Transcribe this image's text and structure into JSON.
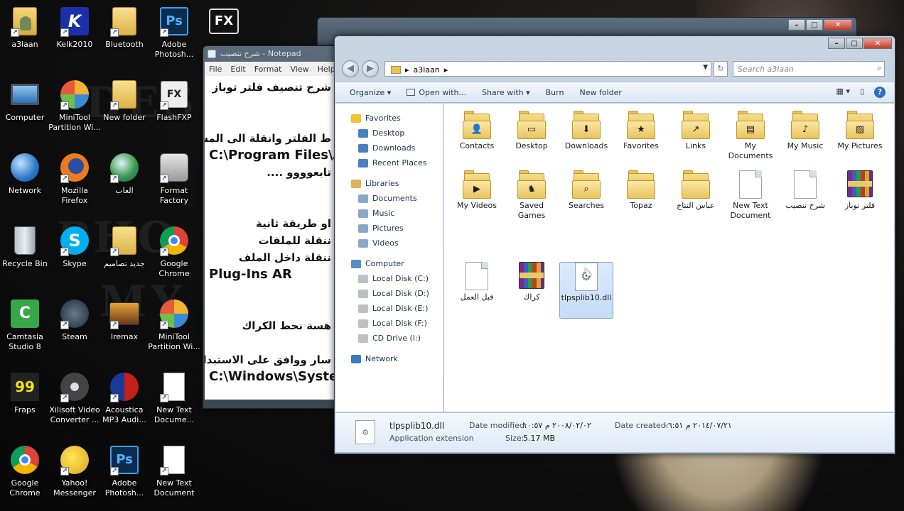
{
  "desktop": {
    "icons": [
      {
        "label": "a3laan",
        "icon": "user-folder-icon"
      },
      {
        "label": "Kelk2010",
        "icon": "kelk-app-icon"
      },
      {
        "label": "Bluetooth",
        "icon": "folder-icon"
      },
      {
        "label": "Adobe Photosh...",
        "icon": "photoshop-icon"
      },
      {
        "label": "Computer",
        "icon": "computer-icon"
      },
      {
        "label": "MiniTool Partition Wi...",
        "icon": "minitool-icon"
      },
      {
        "label": "New folder",
        "icon": "folder-icon"
      },
      {
        "label": "FlashFXP",
        "icon": "flashfxp-icon"
      },
      {
        "label": "Network",
        "icon": "network-icon"
      },
      {
        "label": "Mozilla Firefox",
        "icon": "firefox-icon"
      },
      {
        "label": "العاب",
        "icon": "games-globe-icon"
      },
      {
        "label": "Format Factory",
        "icon": "format-factory-icon"
      },
      {
        "label": "Recycle Bin",
        "icon": "recycle-bin-icon"
      },
      {
        "label": "Skype",
        "icon": "skype-icon"
      },
      {
        "label": "جديد تصاميم",
        "icon": "folder-icon"
      },
      {
        "label": "Google Chrome",
        "icon": "chrome-icon"
      },
      {
        "label": "Camtasia Studio 8",
        "icon": "camtasia-icon"
      },
      {
        "label": "Steam",
        "icon": "steam-icon"
      },
      {
        "label": "Iremax",
        "icon": "iremax-icon"
      },
      {
        "label": "MiniTool Partition Wi...",
        "icon": "minitool-icon"
      },
      {
        "label": "Fraps",
        "icon": "fraps-icon"
      },
      {
        "label": "Xilisoft Video Converter ...",
        "icon": "xilisoft-icon"
      },
      {
        "label": "Acoustica MP3 Audi...",
        "icon": "acoustica-icon"
      },
      {
        "label": "New Text Docume...",
        "icon": "text-document-icon"
      },
      {
        "label": "Google Chrome",
        "icon": "chrome-icon"
      },
      {
        "label": "Yahoo! Messenger",
        "icon": "yahoo-messenger-icon"
      },
      {
        "label": "Adobe Photosh...",
        "icon": "photoshop-icon"
      },
      {
        "label": "New Text Document",
        "icon": "text-document-icon"
      }
    ],
    "fx_label": "FX"
  },
  "notepad": {
    "title": "شرح تنصيب - Notepad",
    "menu": [
      "File",
      "Edit",
      "Format",
      "View",
      "Help"
    ],
    "lines": [
      {
        "text": "شرح تنصيف فلتر توباز",
        "ltr": false
      },
      {
        "text": "",
        "ltr": false
      },
      {
        "text": "",
        "ltr": false
      },
      {
        "text": "ط الفلتر وانقلة الى المسار",
        "ltr": false
      },
      {
        "text": "C:\\Program Files\\A",
        "ltr": true
      },
      {
        "text": "تابعوووو ....",
        "ltr": false
      },
      {
        "text": "",
        "ltr": false
      },
      {
        "text": "",
        "ltr": false
      },
      {
        "text": "او طريقة ثانية",
        "ltr": false
      },
      {
        "text": "ننقلة للملفات",
        "ltr": false
      },
      {
        "text": "ننقلة داخل الملف",
        "ltr": false
      },
      {
        "text": "Plug-Ins AR",
        "ltr": true
      },
      {
        "text": "",
        "ltr": false
      },
      {
        "text": "",
        "ltr": false
      },
      {
        "text": "هسة نحط الكراك",
        "ltr": false
      },
      {
        "text": "",
        "ltr": false
      },
      {
        "text": "سار ووافق على الاستبدال",
        "ltr": false
      },
      {
        "text": "C:\\Windows\\Syste",
        "ltr": true
      }
    ]
  },
  "explorer": {
    "address": {
      "arrow": "▸",
      "path": "a3laan",
      "sep": "▸"
    },
    "search_placeholder": "Search a3laan",
    "toolbar": {
      "organize": "Organize ▾",
      "open_with": "Open with...",
      "share_with": "Share with ▾",
      "burn": "Burn",
      "new_folder": "New folder"
    },
    "nav": {
      "favorites": "Favorites",
      "favorites_items": [
        "Desktop",
        "Downloads",
        "Recent Places"
      ],
      "libraries": "Libraries",
      "libraries_items": [
        "Documents",
        "Music",
        "Pictures",
        "Videos"
      ],
      "computer": "Computer",
      "computer_items": [
        "Local Disk (C:)",
        "Local Disk (D:)",
        "Local Disk (E:)",
        "Local Disk (F:)",
        "CD Drive (I:)"
      ],
      "network": "Network"
    },
    "files": [
      {
        "label": "Contacts",
        "kind": "folder",
        "badge": "👤"
      },
      {
        "label": "Desktop",
        "kind": "folder",
        "badge": "▭"
      },
      {
        "label": "Downloads",
        "kind": "folder",
        "badge": "⬇"
      },
      {
        "label": "Favorites",
        "kind": "folder",
        "badge": "★"
      },
      {
        "label": "Links",
        "kind": "folder",
        "badge": "↗"
      },
      {
        "label": "My Documents",
        "kind": "folder",
        "badge": "▤"
      },
      {
        "label": "My Music",
        "kind": "folder",
        "badge": "♪"
      },
      {
        "label": "My Pictures",
        "kind": "folder",
        "badge": "▨"
      },
      {
        "label": "My Videos",
        "kind": "folder",
        "badge": "▶"
      },
      {
        "label": "Saved Games",
        "kind": "folder",
        "badge": "♞"
      },
      {
        "label": "Searches",
        "kind": "folder",
        "badge": "⌕"
      },
      {
        "label": "Topaz",
        "kind": "folder",
        "badge": ""
      },
      {
        "label": "عباس النتاج",
        "kind": "folder",
        "badge": ""
      },
      {
        "label": "New Text Document",
        "kind": "doc",
        "badge": ""
      },
      {
        "label": "شرح تنصيب",
        "kind": "doc",
        "badge": ""
      },
      {
        "label": "فلتر توباز",
        "kind": "rar",
        "badge": ""
      },
      {
        "label": "قبل العمل",
        "kind": "doc",
        "badge": ""
      },
      {
        "label": "كراك",
        "kind": "rar",
        "badge": ""
      },
      {
        "label": "tlpsplib10.dll",
        "kind": "dll",
        "badge": "⚙"
      }
    ],
    "details": {
      "name": "tlpsplib10.dll",
      "type": "Application extension",
      "modified_label": "Date modified:",
      "modified": "٢٠٠٨/٠٢/٠٢ م ١٠:٥٧",
      "size_label": "Size:",
      "size": "5.17 MB",
      "created_label": "Date created:",
      "created": "٢٠١٤/٠٧/٢١ م ٠٦:٥١"
    }
  },
  "watermark": {
    "line1": "DES",
    "line2": "PHO",
    "line3": "MY"
  }
}
